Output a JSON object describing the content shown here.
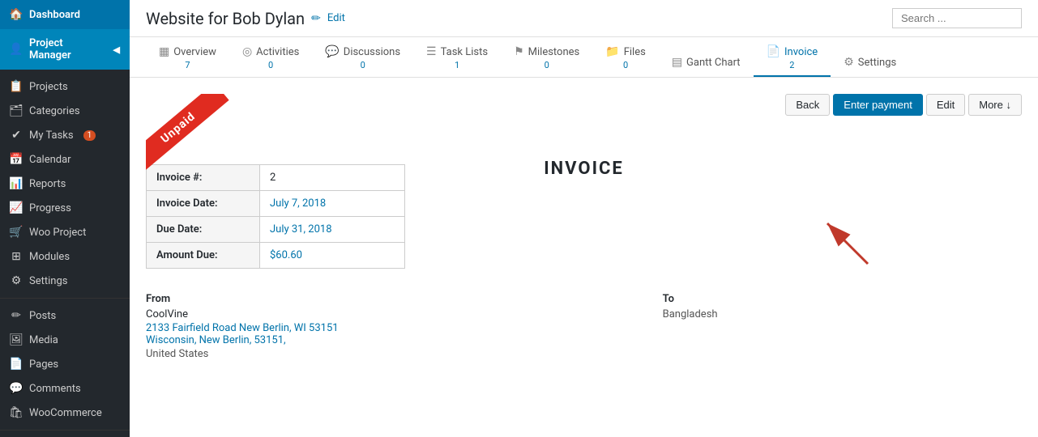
{
  "sidebar": {
    "dashboard": "Dashboard",
    "project_manager": "Project Manager",
    "items": [
      {
        "id": "projects",
        "label": "Projects",
        "active": false,
        "badge": null
      },
      {
        "id": "categories",
        "label": "Categories",
        "active": false,
        "badge": null
      },
      {
        "id": "my-tasks",
        "label": "My Tasks",
        "active": false,
        "badge": "1"
      },
      {
        "id": "calendar",
        "label": "Calendar",
        "active": false,
        "badge": null
      },
      {
        "id": "reports",
        "label": "Reports",
        "active": false,
        "badge": null
      },
      {
        "id": "progress",
        "label": "Progress",
        "active": false,
        "badge": null
      },
      {
        "id": "woo-project",
        "label": "Woo Project",
        "active": false,
        "badge": null
      },
      {
        "id": "modules",
        "label": "Modules",
        "active": false,
        "badge": null
      },
      {
        "id": "settings",
        "label": "Settings",
        "active": false,
        "badge": null
      }
    ],
    "bottom_items": [
      {
        "id": "posts",
        "label": "Posts"
      },
      {
        "id": "media",
        "label": "Media"
      },
      {
        "id": "pages",
        "label": "Pages"
      },
      {
        "id": "comments",
        "label": "Comments"
      },
      {
        "id": "woocommerce",
        "label": "WooCommerce"
      }
    ]
  },
  "topbar": {
    "project_title": "Website for Bob Dylan",
    "edit_label": "Edit",
    "search_placeholder": "Search ..."
  },
  "tabs": [
    {
      "id": "overview",
      "label": "Overview",
      "count": "7",
      "icon": "▦"
    },
    {
      "id": "activities",
      "label": "Activities",
      "count": "0",
      "icon": "◎"
    },
    {
      "id": "discussions",
      "label": "Discussions",
      "count": "0",
      "icon": "💬"
    },
    {
      "id": "task-lists",
      "label": "Task Lists",
      "count": "1",
      "icon": "☰"
    },
    {
      "id": "milestones",
      "label": "Milestones",
      "count": "0",
      "icon": "⚑"
    },
    {
      "id": "files",
      "label": "Files",
      "count": "0",
      "icon": "📁"
    },
    {
      "id": "gantt-chart",
      "label": "Gantt Chart",
      "count": "",
      "icon": "▤"
    },
    {
      "id": "invoice",
      "label": "Invoice",
      "count": "2",
      "icon": "📄"
    },
    {
      "id": "settings",
      "label": "Settings",
      "count": "",
      "icon": "⚙"
    }
  ],
  "invoice": {
    "ribbon_text": "Unpaid",
    "heading": "INVOICE",
    "number_label": "Invoice #:",
    "number_value": "2",
    "date_label": "Invoice Date:",
    "date_value": "July 7, 2018",
    "due_label": "Due Date:",
    "due_value": "July 31, 2018",
    "amount_label": "Amount Due:",
    "amount_value": "$60.60",
    "buttons": {
      "back": "Back",
      "enter_payment": "Enter payment",
      "edit": "Edit",
      "more": "More"
    },
    "from": {
      "label": "From",
      "company": "CoolVine",
      "address1": "2133 Fairfield Road New Berlin, WI 53151",
      "address2": "Wisconsin, New Berlin, 53151,",
      "address3": "United States"
    },
    "to": {
      "label": "To",
      "value": "Bangladesh"
    }
  }
}
